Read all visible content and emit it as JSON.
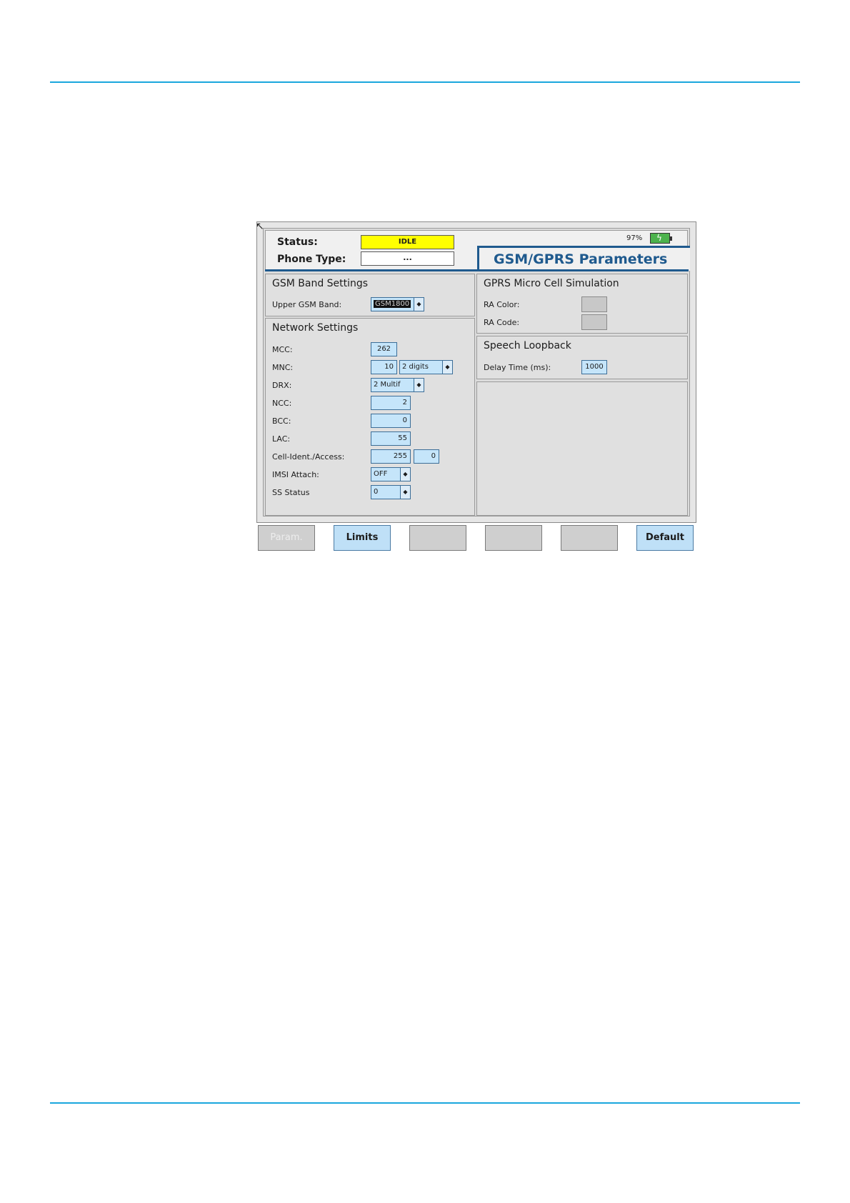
{
  "header": {
    "status_label": "Status:",
    "status_value": "IDLE",
    "phone_type_label": "Phone Type:",
    "phone_type_value": "...",
    "battery_percent": "97%",
    "title": "GSM/GPRS Parameters"
  },
  "gsm_band": {
    "title": "GSM Band Settings",
    "upper_band_label": "Upper GSM Band:",
    "upper_band_value": "GSM1800"
  },
  "network": {
    "title": "Network Settings",
    "mcc_label": "MCC:",
    "mcc_value": "262",
    "mnc_label": "MNC:",
    "mnc_value": "10",
    "mnc_digits": "2 digits",
    "drx_label": "DRX:",
    "drx_value": "2 Multif",
    "ncc_label": "NCC:",
    "ncc_value": "2",
    "bcc_label": "BCC:",
    "bcc_value": "0",
    "lac_label": "LAC:",
    "lac_value": "55",
    "cell_label": "Cell-Ident./Access:",
    "cell_value": "255",
    "access_value": "0",
    "imsi_label": "IMSI Attach:",
    "imsi_value": "OFF",
    "ss_label": "SS Status",
    "ss_value": "0"
  },
  "gprs": {
    "title": "GPRS Micro Cell Simulation",
    "ra_color_label": "RA Color:",
    "ra_code_label": "RA Code:"
  },
  "speech": {
    "title": "Speech Loopback",
    "delay_label": "Delay Time (ms):",
    "delay_value": "1000"
  },
  "softkeys": [
    "Param.",
    "Limits",
    "",
    "",
    "",
    "Default"
  ],
  "colors": {
    "status_idle": "#ffff00",
    "accent": "#1f5a8e",
    "field_bg": "#c5e5fa",
    "page_rule": "#1aa7dd"
  }
}
